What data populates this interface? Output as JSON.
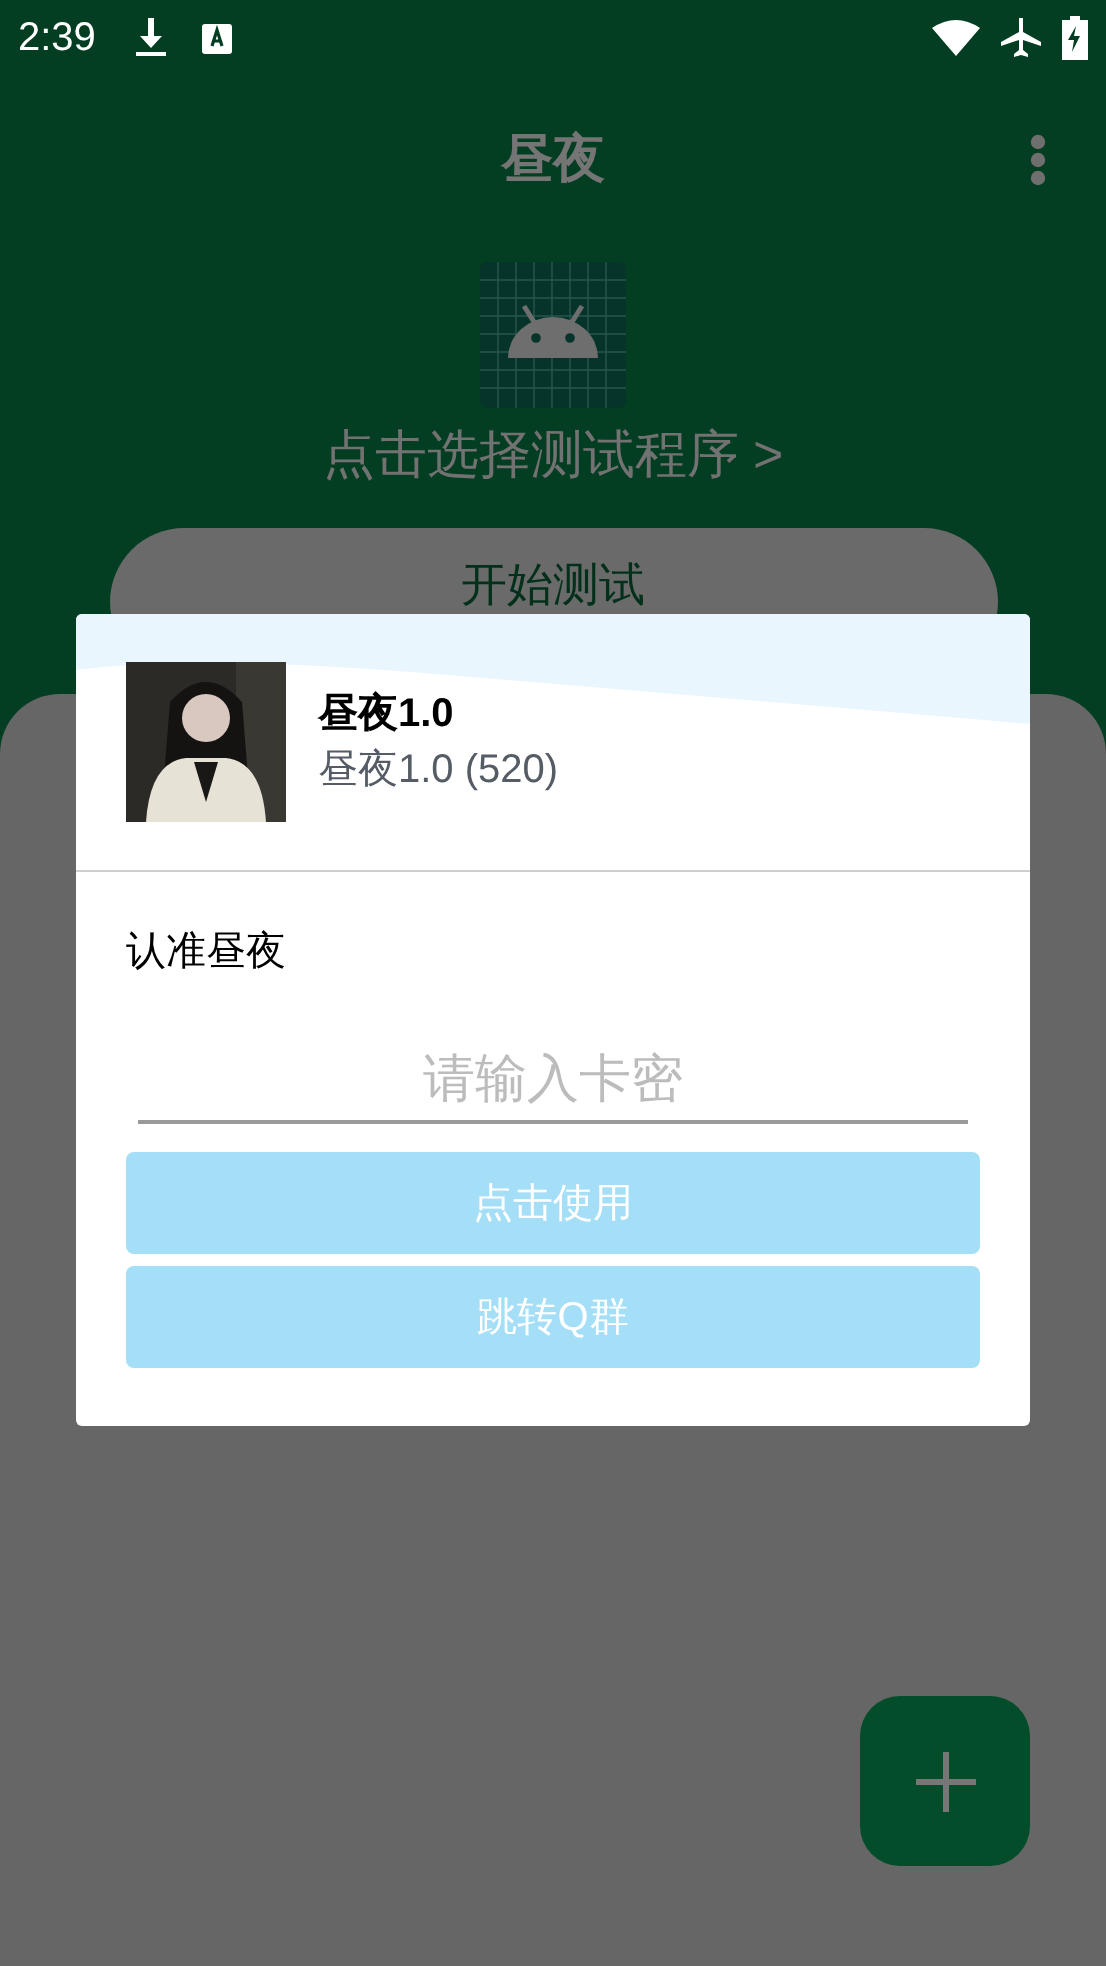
{
  "status_bar": {
    "time": "2:39"
  },
  "toolbar": {
    "title": "昼夜"
  },
  "app_picker": {
    "label": "点击选择测试程序 >"
  },
  "start_button": {
    "label": "开始测试"
  },
  "dialog": {
    "app_name": "昼夜1.0",
    "app_version": "昼夜1.0 (520)",
    "notice": "认准昼夜",
    "card_key_field": {
      "placeholder": "请输入卡密"
    },
    "buttons": [
      {
        "label": "点击使用"
      },
      {
        "label": "跳转Q群"
      }
    ]
  }
}
